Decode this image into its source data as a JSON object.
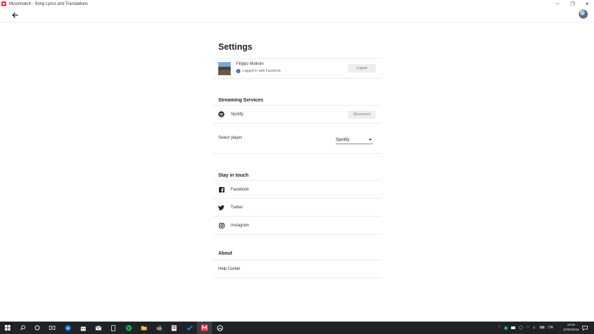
{
  "window": {
    "title": "Musixmatch - Song Lyrics and Translations"
  },
  "page": {
    "title": "Settings"
  },
  "profile": {
    "name": "Filippo Molinini",
    "login_text": "Logged in with Facebook",
    "logout_label": "Logout"
  },
  "streaming": {
    "heading": "Streaming Services",
    "service_name": "Spotify",
    "disconnect_label": "Disconnect",
    "select_player_label": "Select player",
    "player_value": "Spotify"
  },
  "stay_in_touch": {
    "heading": "Stay in touch",
    "items": [
      {
        "label": "Facebook",
        "icon": "facebook-icon"
      },
      {
        "label": "Twitter",
        "icon": "twitter-icon"
      },
      {
        "label": "Instagram",
        "icon": "instagram-icon"
      }
    ]
  },
  "about": {
    "heading": "About",
    "help_center": "Help Center"
  },
  "taskbar": {
    "time": "10:54",
    "date": "22/03/2019",
    "language": "ITA"
  },
  "colors": {
    "facebook": "#3b5998",
    "musixmatch": "#e8334a",
    "spotify": "#1db954",
    "taskbar": "#1f2227"
  }
}
